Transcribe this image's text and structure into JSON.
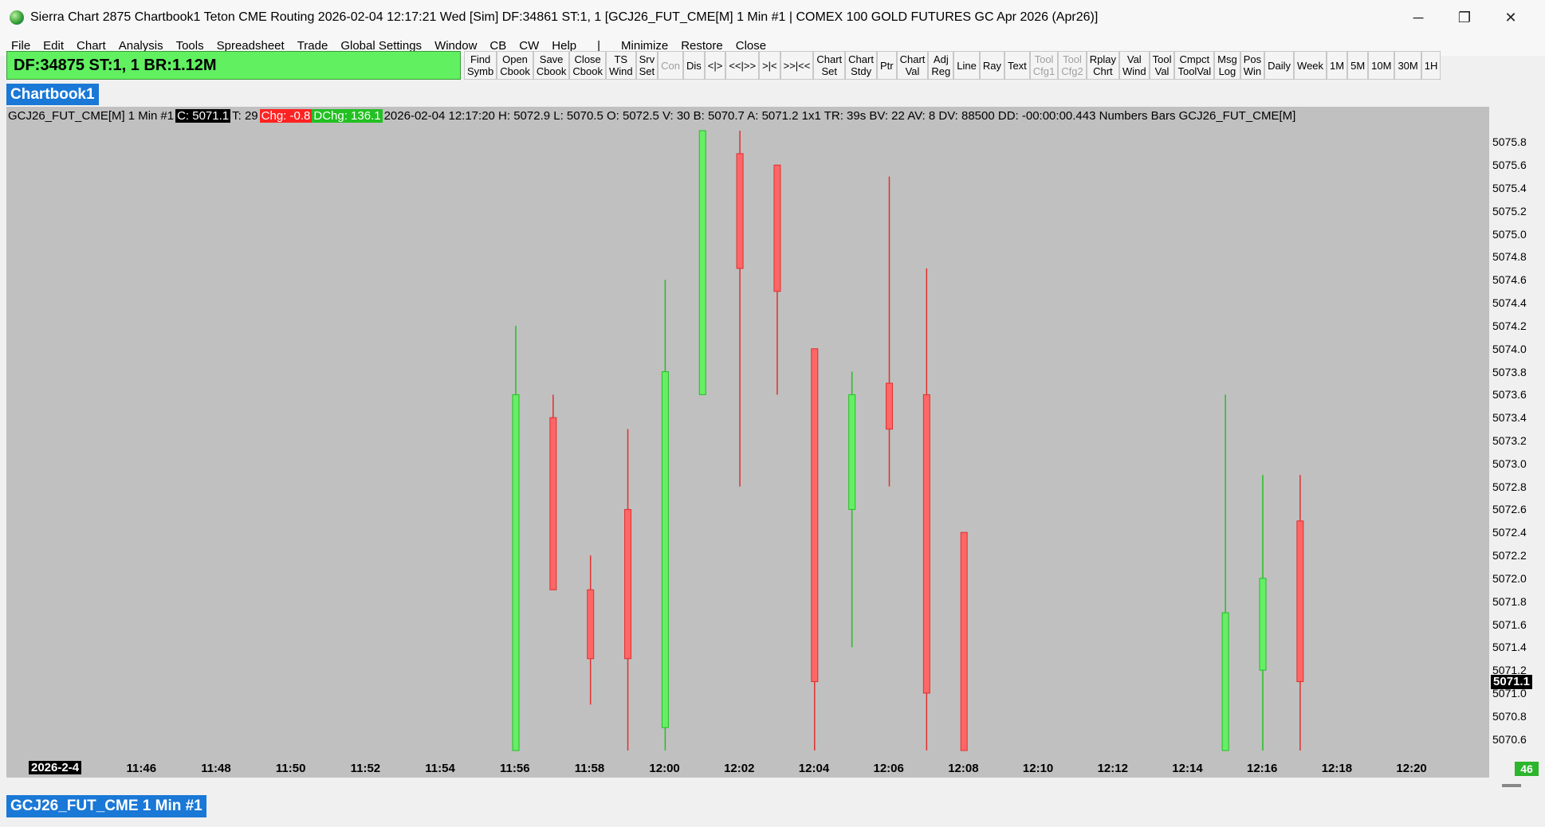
{
  "window": {
    "title": "Sierra Chart 2875 Chartbook1 Teton CME Routing 2026-02-04  12:17:21 Wed [Sim] DF:34861  ST:1, 1  [GCJ26_FUT_CME[M]  1 Min  #1 | COMEX 100 GOLD FUTURES GC Apr 2026 (Apr26)]",
    "controls": {
      "minimize": "─",
      "maximize": "❐",
      "close": "✕"
    }
  },
  "menu": [
    "File",
    "Edit",
    "Chart",
    "Analysis",
    "Tools",
    "Spreadsheet",
    "Trade",
    "Global Settings",
    "Window",
    "CB",
    "CW",
    "Help",
    "|",
    "Minimize",
    "Restore",
    "Close"
  ],
  "status": {
    "text": "DF:34875  ST:1, 1  BR:1.12M"
  },
  "toolbar": [
    {
      "label": "Find\nSymb",
      "enabled": true
    },
    {
      "label": "Open\nCbook",
      "enabled": true
    },
    {
      "label": "Save\nCbook",
      "enabled": true
    },
    {
      "label": "Close\nCbook",
      "enabled": true
    },
    {
      "label": "TS\nWind",
      "enabled": true
    },
    {
      "label": "Srv\nSet",
      "enabled": true
    },
    {
      "label": "Con",
      "enabled": false
    },
    {
      "label": "Dis",
      "enabled": true
    },
    {
      "label": "<|>",
      "enabled": true
    },
    {
      "label": "<<|>>",
      "enabled": true
    },
    {
      "label": ">|<",
      "enabled": true
    },
    {
      "label": ">>|<<",
      "enabled": true
    },
    {
      "label": "Chart\nSet",
      "enabled": true
    },
    {
      "label": "Chart\nStdy",
      "enabled": true
    },
    {
      "label": "Ptr",
      "enabled": true
    },
    {
      "label": "Chart\nVal",
      "enabled": true
    },
    {
      "label": "Adj\nReg",
      "enabled": true
    },
    {
      "label": "Line",
      "enabled": true
    },
    {
      "label": "Ray",
      "enabled": true
    },
    {
      "label": "Text",
      "enabled": true
    },
    {
      "label": "Tool\nCfg1",
      "enabled": false
    },
    {
      "label": "Tool\nCfg2",
      "enabled": false
    },
    {
      "label": "Rplay\nChrt",
      "enabled": true
    },
    {
      "label": "Val\nWind",
      "enabled": true
    },
    {
      "label": "Tool\nVal",
      "enabled": true
    },
    {
      "label": "Cmpct\nToolVal",
      "enabled": true
    },
    {
      "label": "Msg\nLog",
      "enabled": true
    },
    {
      "label": "Pos\nWin",
      "enabled": true
    },
    {
      "label": "Daily",
      "enabled": true
    },
    {
      "label": "Week",
      "enabled": true
    },
    {
      "label": "1M",
      "enabled": true
    },
    {
      "label": "5M",
      "enabled": true
    },
    {
      "label": "10M",
      "enabled": true
    },
    {
      "label": "30M",
      "enabled": true
    },
    {
      "label": "1H",
      "enabled": true
    }
  ],
  "chartbook_tab": "Chartbook1",
  "chart_header": {
    "symbol": "GCJ26_FUT_CME[M]",
    "interval": "1 Min",
    "id": "#1",
    "close": "C: 5071.1",
    "trades": "T: 29",
    "change": "Chg: -0.8",
    "dchange": "DChg: 136.1",
    "info": "2026-02-04 12:17:20 H: 5072.9 L: 5070.5 O: 5072.5 V: 30 B: 5070.7 A: 5071.2 1x1 TR: 39s BV: 22 AV: 8 DV: 88500 DD: -00:00:00.443 Numbers Bars  GCJ26_FUT_CME[M]"
  },
  "price_axis": {
    "labels": [
      "5075.8",
      "5075.6",
      "5075.4",
      "5075.2",
      "5075.0",
      "5074.8",
      "5074.6",
      "5074.4",
      "5074.2",
      "5074.0",
      "5073.8",
      "5073.6",
      "5073.4",
      "5073.2",
      "5073.0",
      "5072.8",
      "5072.6",
      "5072.4",
      "5072.2",
      "5072.0",
      "5071.8",
      "5071.6",
      "5071.4",
      "5071.2",
      "5071.0",
      "5070.8",
      "5070.6"
    ],
    "current": "5071.1"
  },
  "time_axis": {
    "date": "2026-2-4",
    "labels": [
      "11:46",
      "11:48",
      "11:50",
      "11:52",
      "11:54",
      "11:56",
      "11:58",
      "12:00",
      "12:02",
      "12:04",
      "12:06",
      "12:08",
      "12:10",
      "12:12",
      "12:14",
      "12:16",
      "12:18",
      "12:20"
    ]
  },
  "corner_badge": "46",
  "bottom_tab": "GCJ26_FUT_CME  1 Min  #1",
  "colors": {
    "up": "#66ee66",
    "down": "#ff6666",
    "chart_bg": "#c0c0c0",
    "accent": "#1a78d6"
  },
  "chart_data": {
    "type": "candlestick",
    "title": "GCJ26_FUT_CME[M] 1 Min",
    "style": "Numbers Bars",
    "x_unit": "time",
    "ylim": [
      5070.5,
      5075.9
    ],
    "bars": [
      {
        "time": "11:56",
        "open": 5070.5,
        "high": 5074.2,
        "low": 5070.5,
        "close": 5073.6
      },
      {
        "time": "11:57",
        "open": 5073.4,
        "high": 5073.6,
        "low": 5071.9,
        "close": 5071.9
      },
      {
        "time": "11:58",
        "open": 5071.9,
        "high": 5072.2,
        "low": 5070.9,
        "close": 5071.3
      },
      {
        "time": "11:59",
        "open": 5072.6,
        "high": 5073.3,
        "low": 5070.5,
        "close": 5071.3
      },
      {
        "time": "12:00",
        "open": 5070.7,
        "high": 5074.6,
        "low": 5070.5,
        "close": 5073.8
      },
      {
        "time": "12:01",
        "open": 5073.6,
        "high": 5075.9,
        "low": 5073.6,
        "close": 5075.9
      },
      {
        "time": "12:02",
        "open": 5075.7,
        "high": 5075.9,
        "low": 5072.8,
        "close": 5074.7
      },
      {
        "time": "12:03",
        "open": 5075.6,
        "high": 5075.6,
        "low": 5073.6,
        "close": 5074.5
      },
      {
        "time": "12:04",
        "open": 5074.0,
        "high": 5074.0,
        "low": 5070.5,
        "close": 5071.1
      },
      {
        "time": "12:05",
        "open": 5072.6,
        "high": 5073.8,
        "low": 5071.4,
        "close": 5073.6
      },
      {
        "time": "12:06",
        "open": 5073.7,
        "high": 5075.5,
        "low": 5072.8,
        "close": 5073.3
      },
      {
        "time": "12:07",
        "open": 5073.6,
        "high": 5074.7,
        "low": 5070.5,
        "close": 5071.0
      },
      {
        "time": "12:08",
        "open": 5072.4,
        "high": 5072.4,
        "low": 5070.5,
        "close": 5070.5
      },
      {
        "time": "12:15",
        "open": 5070.5,
        "high": 5073.6,
        "low": 5070.5,
        "close": 5071.7
      },
      {
        "time": "12:16",
        "open": 5071.2,
        "high": 5072.9,
        "low": 5070.5,
        "close": 5072.0
      },
      {
        "time": "12:17",
        "open": 5072.5,
        "high": 5072.9,
        "low": 5070.5,
        "close": 5071.1
      }
    ]
  }
}
